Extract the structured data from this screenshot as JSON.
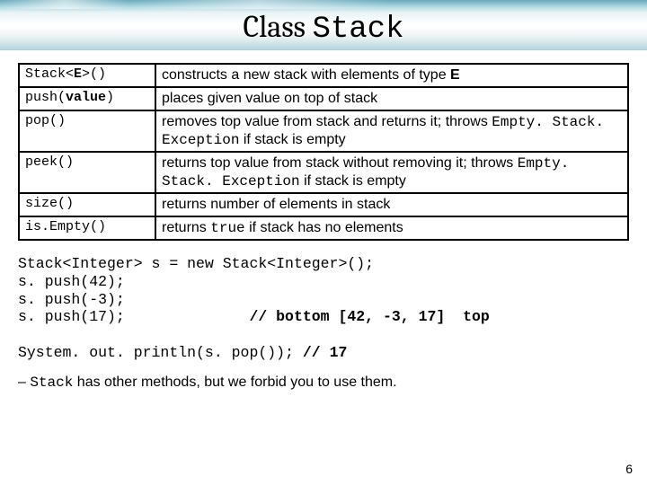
{
  "title": {
    "prefix": "Class ",
    "mono": "Stack"
  },
  "table": {
    "rows": [
      {
        "method_html": "Stack&lt;<span class='b'>E</span>&gt;()",
        "desc_html": "constructs a new stack with elements of type <span class='b'>E</span>"
      },
      {
        "method_html": "push(<span class='b'>value</span>)",
        "desc_html": "places given value on top of stack"
      },
      {
        "method_html": "pop()",
        "desc_html": "removes top value from stack and returns it; throws <span class='mono'>Empty. Stack. Exception</span> if stack is empty"
      },
      {
        "method_html": "peek()",
        "desc_html": "returns top value from stack without removing it; throws <span class='mono'>Empty. Stack. Exception</span> if stack is empty"
      },
      {
        "method_html": "size()",
        "desc_html": "returns number of elements in stack"
      },
      {
        "method_html": "is.Empty()",
        "desc_html": "returns <span class='mono'>true</span> if stack has no elements"
      }
    ]
  },
  "code": {
    "line1": "Stack<Integer> s = new Stack<Integer>();",
    "line2": "s. push(42);",
    "line3": "s. push(-3);",
    "line4": "s. push(17);",
    "comment4": "// bottom [42, -3, 17]  top",
    "line5": "System. out. println(s. pop());",
    "comment5": "// 17"
  },
  "footnote": {
    "dash": "– ",
    "mono": "Stack",
    "rest": " has other methods, but we forbid you to use them."
  },
  "pagenum": "6"
}
